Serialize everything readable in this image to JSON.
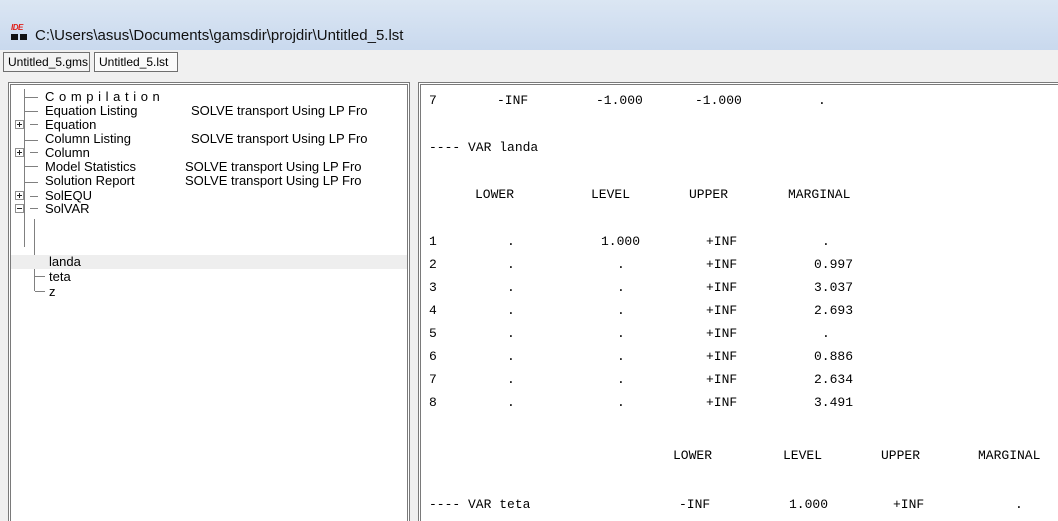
{
  "window": {
    "icon_text": "IDE",
    "title": "C:\\Users\\asus\\Documents\\gamsdir\\projdir\\Untitled_5.lst"
  },
  "tabs": [
    {
      "label": "Untitled_5.gms",
      "active": false
    },
    {
      "label": "Untitled_5.lst",
      "active": true
    }
  ],
  "tree": {
    "compilation": "C o m p i l a t i o n",
    "items": [
      {
        "label": "Equation Listing",
        "detail": "SOLVE transport Using LP Fro"
      },
      {
        "label": "Equation",
        "detail": ""
      },
      {
        "label": "Column Listing",
        "detail": "SOLVE transport Using LP Fro"
      },
      {
        "label": "Column",
        "detail": ""
      },
      {
        "label": "Model Statistics",
        "detail": "SOLVE transport Using LP Fro"
      },
      {
        "label": "Solution Report",
        "detail": "SOLVE transport Using LP Fro"
      },
      {
        "label": "SolEQU",
        "detail": ""
      },
      {
        "label": "SolVAR",
        "detail": ""
      }
    ],
    "solvar_children": [
      "landa",
      "teta",
      "z"
    ]
  },
  "listing": {
    "top_row": {
      "idx": "7",
      "lower": "-INF",
      "level": "-1.000",
      "upper": "-1.000",
      "marginal": "."
    },
    "var_landa_header": "---- VAR landa",
    "columns": {
      "lower": "LOWER",
      "level": "LEVEL",
      "upper": "UPPER",
      "marginal": "MARGINAL"
    },
    "landa_rows": [
      {
        "idx": "1",
        "lower": ".",
        "level": "1.000",
        "upper": "+INF",
        "marginal": "."
      },
      {
        "idx": "2",
        "lower": ".",
        "level": ".",
        "upper": "+INF",
        "marginal": "0.997"
      },
      {
        "idx": "3",
        "lower": ".",
        "level": ".",
        "upper": "+INF",
        "marginal": "3.037"
      },
      {
        "idx": "4",
        "lower": ".",
        "level": ".",
        "upper": "+INF",
        "marginal": "2.693"
      },
      {
        "idx": "5",
        "lower": ".",
        "level": ".",
        "upper": "+INF",
        "marginal": "."
      },
      {
        "idx": "6",
        "lower": ".",
        "level": ".",
        "upper": "+INF",
        "marginal": "0.886"
      },
      {
        "idx": "7",
        "lower": ".",
        "level": ".",
        "upper": "+INF",
        "marginal": "2.634"
      },
      {
        "idx": "8",
        "lower": ".",
        "level": ".",
        "upper": "+INF",
        "marginal": "3.491"
      }
    ],
    "teta_columns": {
      "lower": "LOWER",
      "level": "LEVEL",
      "upper": "UPPER",
      "marginal": "MARGINAL"
    },
    "teta_row": {
      "label": "---- VAR teta",
      "lower": "-INF",
      "level": "1.000",
      "upper": "+INF",
      "marginal": "."
    }
  }
}
